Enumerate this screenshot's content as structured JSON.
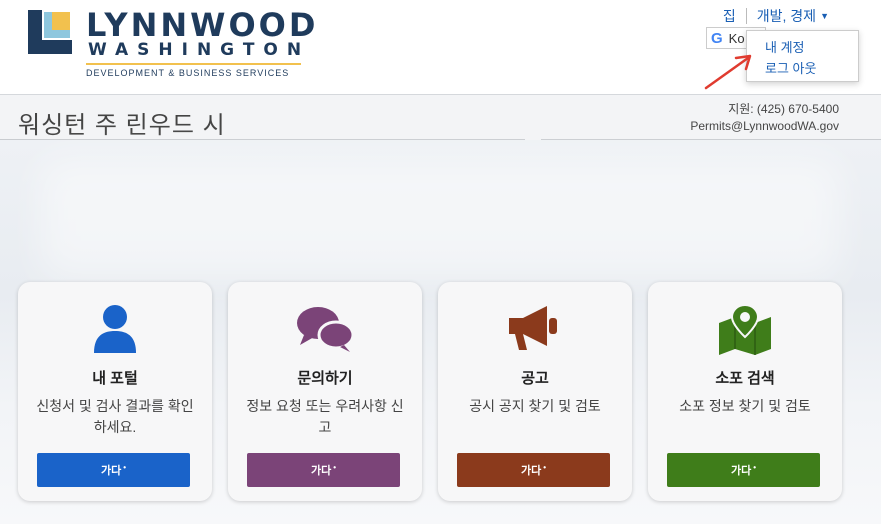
{
  "logo": {
    "title": "LYNNWOOD",
    "subtitle": "WASHINGTON",
    "department": "DEVELOPMENT & BUSINESS SERVICES"
  },
  "topnav": {
    "home": "집",
    "section": "개발, 경제"
  },
  "translate": {
    "label": "Ko"
  },
  "account_menu": {
    "items": [
      "내 계정",
      "로그 아웃"
    ]
  },
  "page": {
    "title": "워싱턴 주 린우드 시"
  },
  "contact": {
    "phone": "지원: (425) 670-5400",
    "email": "Permits@LynnwoodWA.gov"
  },
  "cards": [
    {
      "title": "내 포털",
      "description": "신청서 및 검사 결과를 확인하세요.",
      "button": "가다",
      "color": "#1a63c9",
      "icon": "user-icon"
    },
    {
      "title": "문의하기",
      "description": "정보 요청 또는 우려사항 신고",
      "button": "가다",
      "color": "#7b4478",
      "icon": "chat-bubbles-icon"
    },
    {
      "title": "공고",
      "description": "공시 공지 찾기 및 검토",
      "button": "가다",
      "color": "#8b3a1c",
      "icon": "megaphone-icon"
    },
    {
      "title": "소포 검색",
      "description": "소포 정보 찾기 및 검토",
      "button": "가다",
      "color": "#3f7d1a",
      "icon": "map-pin-icon"
    }
  ],
  "colors": {
    "brand_navy": "#1f3b5c",
    "link": "#1a5fb4",
    "logo_yellow": "#f2c14e",
    "logo_blue": "#8ec7de",
    "annotation_arrow": "#e03b2f"
  }
}
